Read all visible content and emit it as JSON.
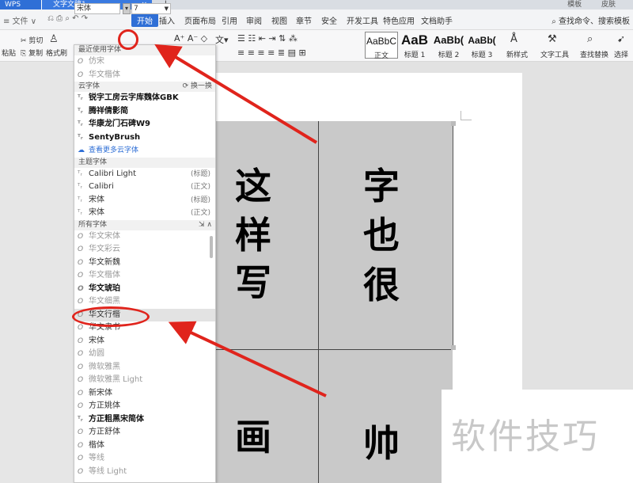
{
  "titlebar": {
    "app": "WPS",
    "doc_tab": "文字文稿1",
    "doc_close": "×",
    "new_tab": "+",
    "right": [
      "模板",
      "皮肤"
    ]
  },
  "menubar": {
    "quick": [
      "≡ 文件 ∨"
    ],
    "items": [
      "开始",
      "插入",
      "页面布局",
      "引用",
      "审阅",
      "视图",
      "章节",
      "安全",
      "开发工具",
      "特色应用",
      "文档助手"
    ],
    "active_index": 0,
    "search": "查找命令、搜索模板"
  },
  "toolbar": {
    "cut": "剪切",
    "copy": "复制",
    "format_painter": "格式刷",
    "paste": "粘贴",
    "font_name": "宋体",
    "font_size": "7",
    "font_size_arrow": "▾",
    "styles": [
      {
        "preview": "AaBbC",
        "name": "正文"
      },
      {
        "preview": "AaB",
        "name": "标题 1"
      },
      {
        "preview": "AaBb(",
        "name": "标题 2"
      },
      {
        "preview": "AaBb(",
        "name": "标题 3"
      }
    ],
    "new_style": "新样式",
    "text_tools": "文字工具",
    "find_replace": "查找替换",
    "select": "选择"
  },
  "dropdown": {
    "recent_header": "最近使用字体",
    "recent": [
      "仿宋",
      "华文楷体"
    ],
    "cloud_header": "云字体",
    "cloud_action": "换一换",
    "cloud": [
      "锐字工房云字库魏体GBK",
      "腾祥倩影简",
      "华康龙门石碑W9",
      "SentyBrush"
    ],
    "cloud_more": "查看更多云字体",
    "theme_header": "主题字体",
    "theme": [
      {
        "name": "Calibri Light",
        "tag": "(标题)"
      },
      {
        "name": "Calibri",
        "tag": "(正文)"
      },
      {
        "name": "宋体",
        "tag": "(标题)"
      },
      {
        "name": "宋体",
        "tag": "(正文)"
      }
    ],
    "all_header": "所有字体",
    "all": [
      "华文宋体",
      "华文彩云",
      "华文新魏",
      "华文楷体",
      "华文琥珀",
      "华文细黑",
      "华文行楷",
      "华文隶书",
      "宋体",
      "幼圆",
      "微软雅黑",
      "微软雅黑 Light",
      "新宋体",
      "方正姚体",
      "方正粗黑宋简体",
      "方正舒体",
      "楷体",
      "等线",
      "等线 Light"
    ],
    "highlighted": "华文行楷"
  },
  "document": {
    "cells": [
      "这",
      "样",
      "写",
      "字",
      "也",
      "很",
      "画",
      "帅"
    ],
    "watermark": "软件技巧"
  },
  "colors": {
    "accent": "#2f6fd6",
    "annotation": "#e0241c",
    "table_fill": "#c9c9c9"
  }
}
